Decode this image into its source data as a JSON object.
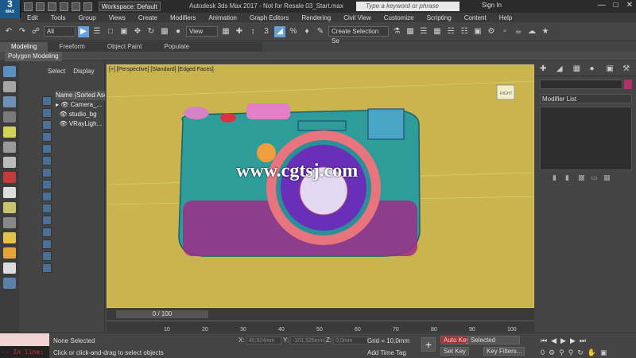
{
  "app": {
    "logo": "3",
    "logo_sub": "MAX",
    "title": "Autodesk 3ds Max 2017 - Not for Resale   03_Start.max",
    "workspace": "Workspace: Default",
    "search_placeholder": "Type a keyword or phrase",
    "signin": "Sign In"
  },
  "menu": [
    "Edit",
    "Tools",
    "Group",
    "Views",
    "Create",
    "Modifiers",
    "Animation",
    "Graph Editors",
    "Rendering",
    "Civil View",
    "Customize",
    "Scripting",
    "Content",
    "Help"
  ],
  "toolbar": {
    "filter": "All",
    "refcoord": "View",
    "selset": "Create Selection Se"
  },
  "ribbon": {
    "tabs": [
      "Modeling",
      "Freeform",
      "Object Paint",
      "Populate"
    ],
    "active": "Modeling",
    "sub": "Polygon Modeling"
  },
  "scene": {
    "tabs": [
      "Select",
      "Display"
    ],
    "header": "Name (Sorted Ascer",
    "items": [
      "Camera_...",
      "studio_bg",
      "VRayLigh..."
    ]
  },
  "viewport": {
    "label": "[+] [Perspective] [Standard] [Edged Faces]",
    "watermark": "www.cgtsj.com",
    "cube_label": "RIGHT"
  },
  "right": {
    "modifier_list": "Modifier List"
  },
  "timeline": {
    "slider": "0 / 100",
    "ticks": [
      "10",
      "20",
      "30",
      "40",
      "50",
      "60",
      "70",
      "80",
      "90",
      "100"
    ]
  },
  "status": {
    "selected": "None Selected",
    "hint": "Click or click-and-drag to select objects",
    "maxscript": "-- In line:",
    "x_label": "X:",
    "x_val": "40,924mm",
    "y_label": "Y:",
    "y_val": "-101,525mm",
    "z_label": "Z:",
    "z_val": "0,0mm",
    "grid": "Grid = 10,0mm",
    "add_time_tag": "Add Time Tag",
    "auto_key": "Auto Key",
    "set_key": "Set Key",
    "selected_dd": "Selected",
    "key_filters": "Key Filters...",
    "frame": "0"
  },
  "colors": {
    "viewport_bg": "#c9b44e",
    "accent": "#6aa0d8"
  }
}
